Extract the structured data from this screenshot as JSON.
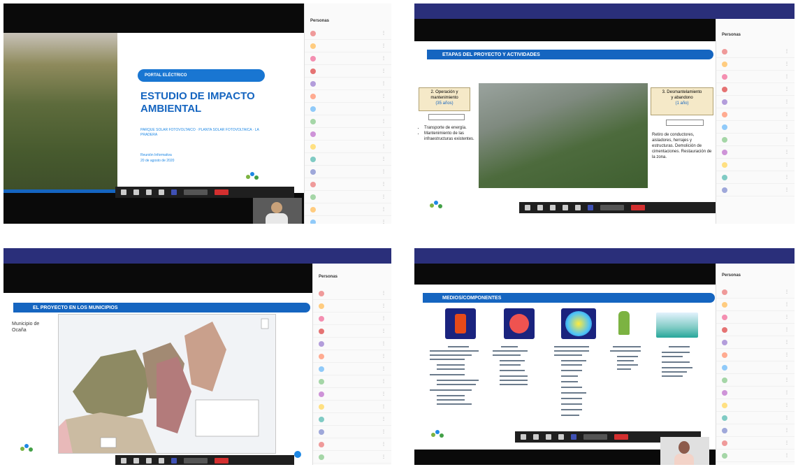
{
  "q1": {
    "badge": "PORTAL ELÉCTRICO",
    "title_line1": "ESTUDIO DE IMPACTO",
    "title_line2": "AMBIENTAL",
    "subtitle": "PARQUE SOLAR FOTOVOLTAICO · PLANTA SOLAR FOTOVOLTAICA · LA PRADERA",
    "presenter": "Reunión Informativa",
    "date": "20 de agosto de 2020",
    "footer_link": "",
    "caption": "",
    "panel_title": "Personas",
    "participants": [
      "",
      "",
      "",
      "",
      "",
      "",
      "",
      "",
      "",
      "",
      "",
      "",
      "",
      "",
      "",
      ""
    ]
  },
  "q2": {
    "banner": "",
    "banner_right": "",
    "slide_title": "ETAPAS DEL PROYECTO Y ACTIVIDADES",
    "left_box_line1": "2. Operación y",
    "left_box_line2": "mantenimiento",
    "left_box_line3": "(35 años)",
    "left_tag": "",
    "left_bullets": [
      "Transporte de energía.",
      "Mantenimiento de las infraestructuras existentes."
    ],
    "right_box_line1": "3. Desmantelamiento",
    "right_box_line2": "y abandono",
    "right_box_line3": "(1 año)",
    "right_tag": "",
    "right_text": "Retiro de conductores, aisladores, herrajes y estructuras. Demolición de cimentaciones. Restauración de la zona.",
    "panel_title": "Personas",
    "participants": [
      "",
      "",
      "",
      "",
      "",
      "",
      "",
      "",
      "",
      "",
      "",
      ""
    ]
  },
  "q3": {
    "banner": "",
    "banner_right": "",
    "slide_title": "EL PROYECTO EN LOS MUNICIPIOS",
    "side_label_line1": "Municipio de",
    "side_label_line2": "Ocaña",
    "panel_title": "Personas",
    "participants": [
      "",
      "",
      "",
      "",
      "",
      "",
      "",
      "",
      "",
      "",
      "",
      "",
      "",
      ""
    ]
  },
  "q4": {
    "banner": "",
    "banner_right": "",
    "slide_title": "MEDIOS/COMPONENTES",
    "components": [
      "",
      "",
      "",
      "",
      ""
    ],
    "panel_title": "Personas",
    "participants": [
      "",
      "",
      "",
      "",
      "",
      "",
      "",
      "",
      "",
      "",
      "",
      "",
      "",
      ""
    ]
  },
  "colors": {
    "accent": "#1565c0",
    "banner": "#2a2f7a",
    "end_call": "#d32f2f"
  }
}
